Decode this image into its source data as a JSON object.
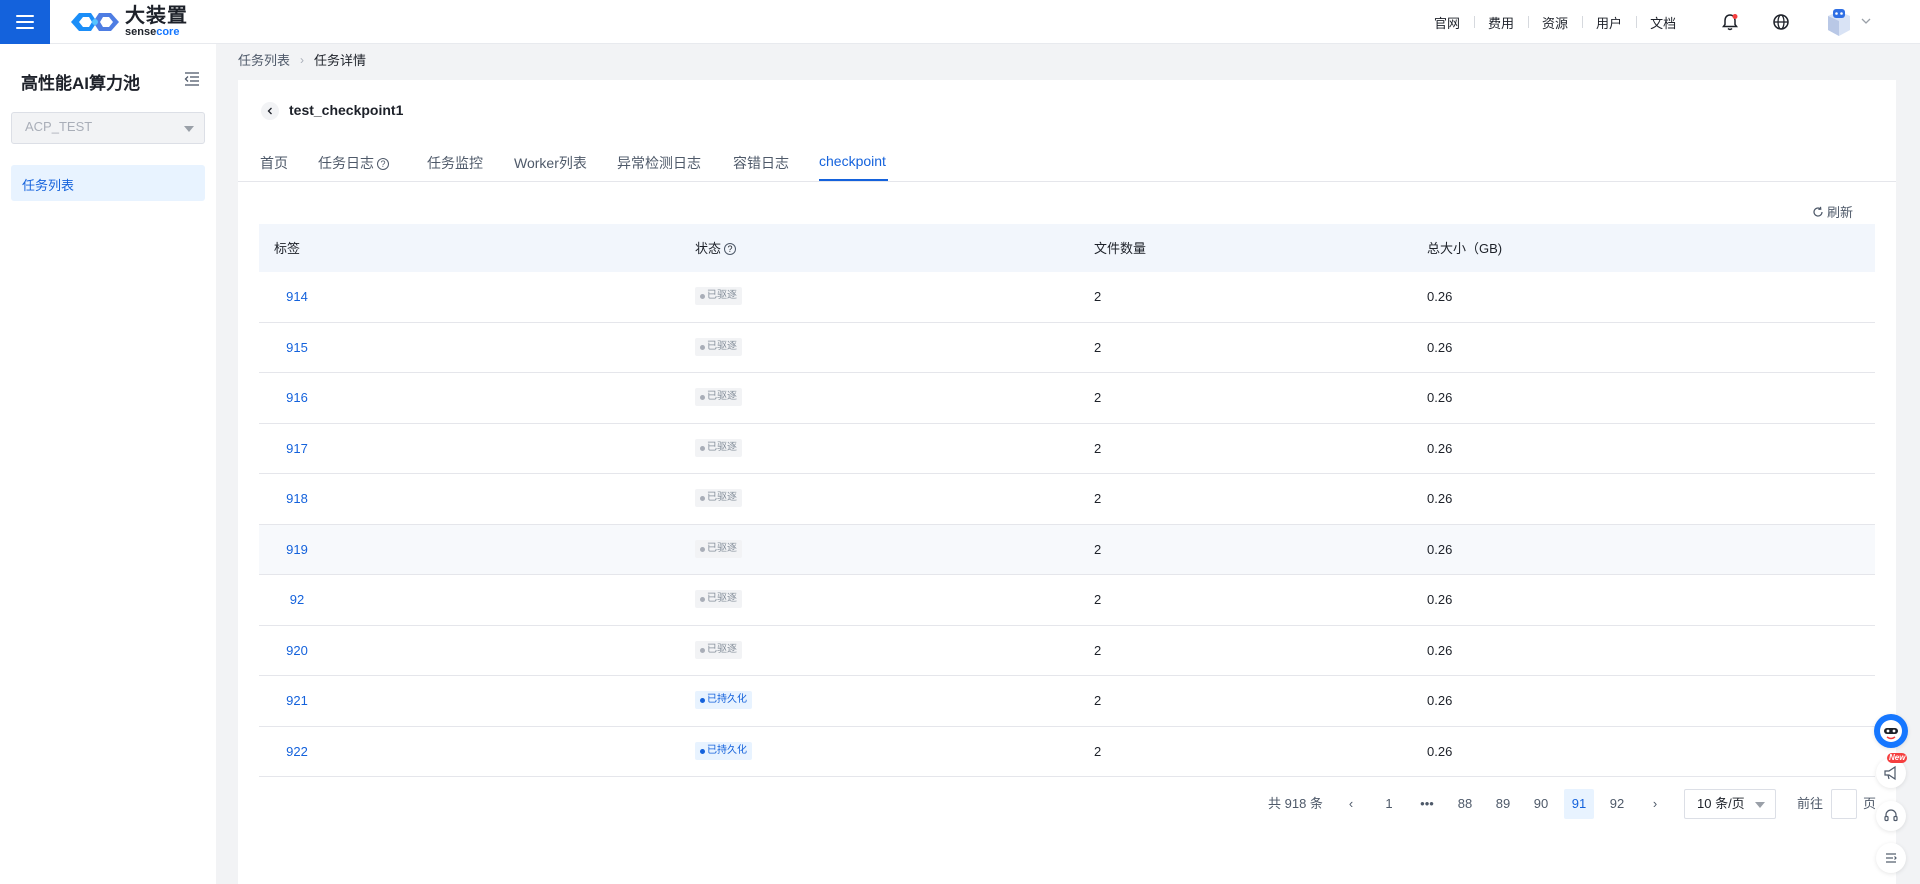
{
  "header": {
    "logo_cn": "大装置",
    "logo_en_prefix": "sense",
    "logo_en_suffix": "core",
    "links": [
      "官网",
      "费用",
      "资源",
      "用户",
      "文档"
    ]
  },
  "sidebar": {
    "title": "高性能AI算力池",
    "select_value": "ACP_TEST",
    "items": [
      {
        "label": "任务列表",
        "active": true
      }
    ]
  },
  "breadcrumb": {
    "parent": "任务列表",
    "current": "任务详情"
  },
  "task": {
    "title": "test_checkpoint1"
  },
  "tabs": [
    "首页",
    "任务日志",
    "任务监控",
    "Worker列表",
    "异常检测日志",
    "容错日志",
    "checkpoint"
  ],
  "active_tab": "checkpoint",
  "refresh_label": "刷新",
  "table": {
    "headers": [
      "标签",
      "状态",
      "文件数量",
      "总大小（GB)"
    ],
    "rows": [
      {
        "tag": "914",
        "status": "已驱逐",
        "status_type": "gray",
        "files": "2",
        "size": "0.26"
      },
      {
        "tag": "915",
        "status": "已驱逐",
        "status_type": "gray",
        "files": "2",
        "size": "0.26"
      },
      {
        "tag": "916",
        "status": "已驱逐",
        "status_type": "gray",
        "files": "2",
        "size": "0.26"
      },
      {
        "tag": "917",
        "status": "已驱逐",
        "status_type": "gray",
        "files": "2",
        "size": "0.26"
      },
      {
        "tag": "918",
        "status": "已驱逐",
        "status_type": "gray",
        "files": "2",
        "size": "0.26"
      },
      {
        "tag": "919",
        "status": "已驱逐",
        "status_type": "gray",
        "files": "2",
        "size": "0.26",
        "highlighted": true
      },
      {
        "tag": "92",
        "status": "已驱逐",
        "status_type": "gray",
        "files": "2",
        "size": "0.26"
      },
      {
        "tag": "920",
        "status": "已驱逐",
        "status_type": "gray",
        "files": "2",
        "size": "0.26"
      },
      {
        "tag": "921",
        "status": "已持久化",
        "status_type": "blue",
        "files": "2",
        "size": "0.26"
      },
      {
        "tag": "922",
        "status": "已持久化",
        "status_type": "blue",
        "files": "2",
        "size": "0.26"
      }
    ]
  },
  "pagination": {
    "total_label": "共 918 条",
    "prev": "‹",
    "next": "›",
    "pages": [
      "1",
      "•••",
      "88",
      "89",
      "90",
      "91",
      "92"
    ],
    "current_page": "91",
    "page_size": "10 条/页",
    "goto_prefix": "前往",
    "goto_suffix": "页"
  },
  "floating": {
    "new_badge": "New"
  },
  "colors": {
    "primary": "#1462dc",
    "menu_bg": "#1462dc",
    "active_bg": "#e8f3ff",
    "notify_dot": "#f53f3f"
  }
}
